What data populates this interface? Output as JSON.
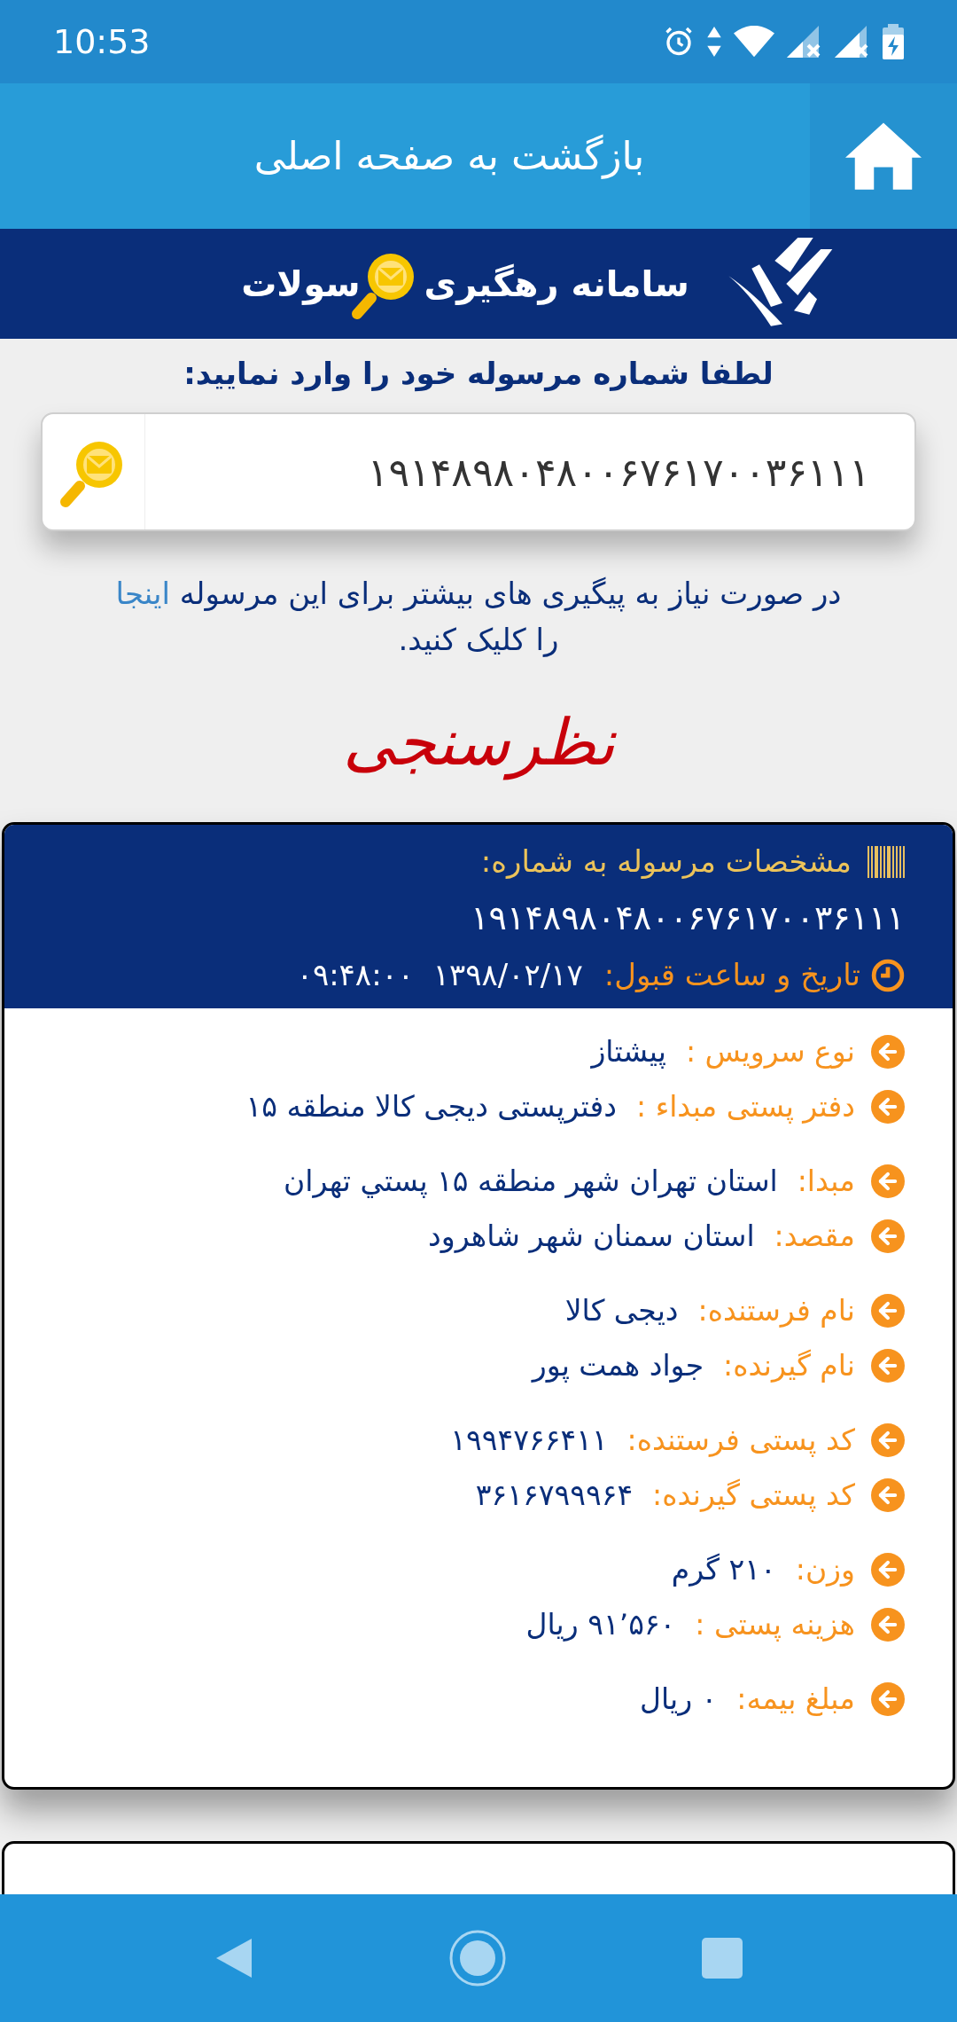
{
  "status_bar": {
    "time": "10:53"
  },
  "app_bar": {
    "title": "بازگشت به صفحه اصلی"
  },
  "banner": {
    "title_start": "سامانه رهگیری",
    "title_end": "سولات"
  },
  "prompt": "لطفا شماره مرسوله خود را وارد نمایید:",
  "tracking_field": {
    "value": "۱۹۱۴۸۹۸۰۴۸۰۰۶۷۶۱۷۰۰۳۶۱۱۱"
  },
  "notice": {
    "before": "در صورت نیاز به پیگیری های بیشتر برای این مرسوله",
    "link": "اینجا",
    "after": "را کلیک کنید."
  },
  "survey_logo": "نظرسنجی",
  "details": {
    "heading": "مشخصات مرسوله به شماره:",
    "number": "۱۹۱۴۸۹۸۰۴۸۰۰۶۷۶۱۷۰۰۳۶۱۱۱",
    "date_label": "تاریخ و ساعت قبول:",
    "date_value": "۱۳۹۸/۰۲/۱۷  ۰۹:۴۸:۰۰",
    "groups": [
      {
        "rows": [
          {
            "label": "نوع سرویس :",
            "value": "پیشتاز"
          },
          {
            "label": "دفتر پستی مبداء :",
            "value": "دفترپستی دیجی کالا منطقه ۱۵"
          }
        ]
      },
      {
        "rows": [
          {
            "label": "مبدا:",
            "value": "استان تهران شهر منطقه ۱۵ پستي تهران"
          },
          {
            "label": "مقصد:",
            "value": "استان سمنان شهر شاهرود"
          }
        ]
      },
      {
        "rows": [
          {
            "label": "نام فرستنده:",
            "value": "دیجی کالا"
          },
          {
            "label": "نام گیرنده:",
            "value": "جواد همت پور"
          }
        ]
      },
      {
        "rows": [
          {
            "label": "کد پستی فرستنده:",
            "value": "۱۹۹۴۷۶۶۴۱۱"
          },
          {
            "label": "کد پستی گیرنده:",
            "value": "۳۶۱۶۷۹۹۹۶۴"
          }
        ]
      },
      {
        "rows": [
          {
            "label": "وزن:",
            "value": "۲۱۰ گرم"
          },
          {
            "label": "هزینه پستی :",
            "value": "۹۱٬۵۶۰ ریال"
          }
        ]
      },
      {
        "rows": [
          {
            "label": "مبلغ بیمه:",
            "value": "۰ ریال"
          }
        ]
      }
    ]
  }
}
